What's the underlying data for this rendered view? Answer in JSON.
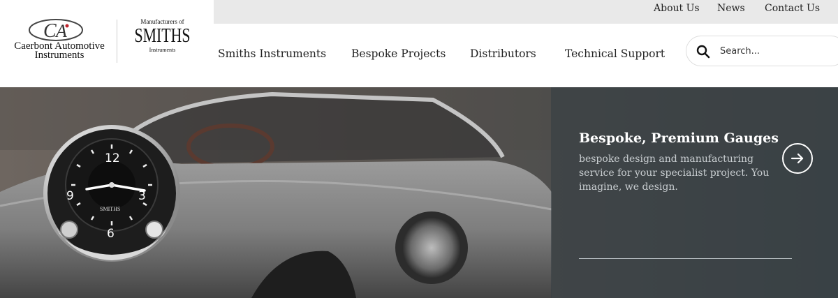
{
  "topbar": {
    "links": [
      "About Us",
      "News",
      "Contact Us"
    ]
  },
  "brand": {
    "logo_line1": "Caerbont Automotive",
    "logo_line2": "Instruments",
    "smiths_tagline": "Manufacturers of",
    "smiths_name": "SMITHS",
    "smiths_sub": "Instruments"
  },
  "nav": {
    "items": [
      "Smiths Instruments",
      "Bespoke Projects",
      "Distributors",
      "Technical Support"
    ]
  },
  "search": {
    "placeholder": "Search..."
  },
  "hero": {
    "title": "Bespoke, Premium Gauges",
    "subtitle": "bespoke design and manufacturing service for your specialist project. You imagine, we design.",
    "gauge_brand": "SMITHS",
    "gauge_numbers": [
      "12",
      "3",
      "6",
      "9"
    ]
  }
}
